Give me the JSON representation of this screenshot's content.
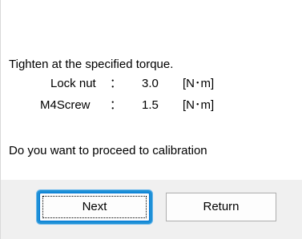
{
  "message": {
    "line1": "Tighten at the specified torque.",
    "rows": [
      {
        "label": "Lock nut",
        "colon": "：",
        "value": "3.0",
        "unit": "[N･m]"
      },
      {
        "label": "M4Screw",
        "colon": "：",
        "value": "1.5",
        "unit": "[N･m]"
      }
    ],
    "question": "Do you want to proceed to calibration"
  },
  "buttons": {
    "next_label": "Next",
    "return_label": "Return"
  },
  "colors": {
    "focus_ring": "#1e90d6",
    "footer_bg": "#f0f0f0"
  }
}
